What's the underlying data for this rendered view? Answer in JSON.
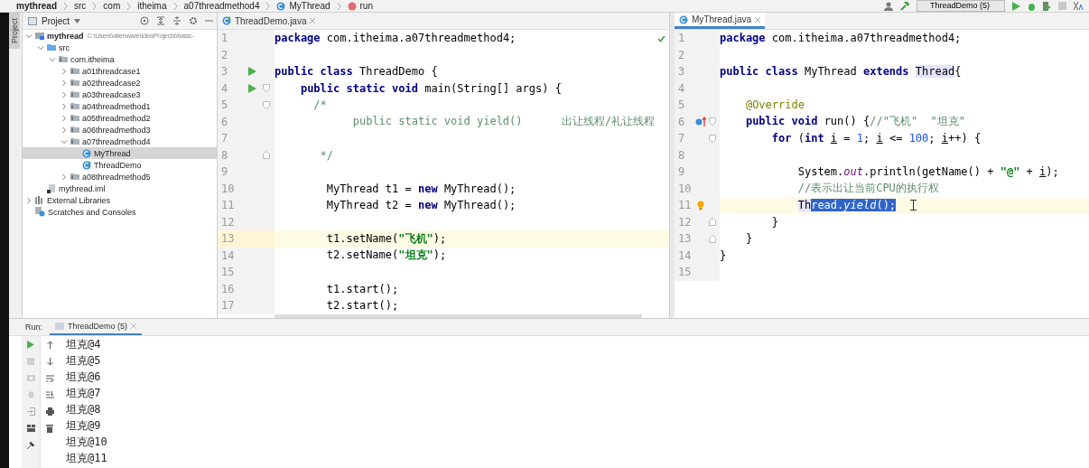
{
  "breadcrumbs": [
    {
      "label": "mythread",
      "kind": "module"
    },
    {
      "label": "src",
      "kind": "folder"
    },
    {
      "label": "com",
      "kind": "folder"
    },
    {
      "label": "itheima",
      "kind": "folder"
    },
    {
      "label": "a07threadmethod4",
      "kind": "folder"
    },
    {
      "label": "MyThread",
      "kind": "class"
    },
    {
      "label": "run",
      "kind": "method"
    }
  ],
  "run_config": {
    "label": "ThreadDemo (5)"
  },
  "tool_strip": {
    "label": "Project",
    "selected": true
  },
  "project_panel": {
    "title": "Project",
    "tree": [
      {
        "label": "mythread",
        "path": "C:\\Users\\alienware\\IdeaProjects\\basic-",
        "kind": "module",
        "expanded": true,
        "selected": false,
        "children": [
          {
            "label": "src",
            "kind": "folder",
            "expanded": true,
            "selected": false,
            "children": [
              {
                "label": "com.itheima",
                "kind": "package",
                "expanded": true,
                "selected": false,
                "children": [
                  {
                    "label": "a01threadcase1",
                    "kind": "package",
                    "expanded": false,
                    "selected": false
                  },
                  {
                    "label": "a02threadcase2",
                    "kind": "package",
                    "expanded": false,
                    "selected": false
                  },
                  {
                    "label": "a03threadcase3",
                    "kind": "package",
                    "expanded": false,
                    "selected": false
                  },
                  {
                    "label": "a04threadmethod1",
                    "kind": "package",
                    "expanded": false,
                    "selected": false
                  },
                  {
                    "label": "a05threadmethod2",
                    "kind": "package",
                    "expanded": false,
                    "selected": false
                  },
                  {
                    "label": "a06threadmethod3",
                    "kind": "package",
                    "expanded": false,
                    "selected": false
                  },
                  {
                    "label": "a07threadmethod4",
                    "kind": "package",
                    "expanded": true,
                    "selected": false,
                    "children": [
                      {
                        "label": "MyThread",
                        "kind": "class",
                        "selected": true
                      },
                      {
                        "label": "ThreadDemo",
                        "kind": "runclass",
                        "selected": false
                      }
                    ]
                  },
                  {
                    "label": "a08threadmethod5",
                    "kind": "package",
                    "expanded": false,
                    "selected": false
                  }
                ]
              }
            ]
          },
          {
            "label": "mythread.iml",
            "kind": "file",
            "selected": false
          }
        ]
      },
      {
        "label": "External Libraries",
        "kind": "library",
        "expanded": false,
        "selected": false
      },
      {
        "label": "Scratches and Consoles",
        "kind": "scratches",
        "selected": false
      }
    ]
  },
  "editors": [
    {
      "tab": {
        "label": "ThreadDemo.java",
        "kind": "runclass",
        "selected": false
      },
      "inspection_ok": true,
      "lines": [
        {
          "number": "1",
          "current": false,
          "tokens": [
            {
              "kind": "kw",
              "text": "package"
            },
            {
              "kind": "txt",
              "text": " com.itheima.a07threadmethod4;"
            }
          ]
        },
        {
          "number": "2",
          "current": false
        },
        {
          "number": "3",
          "current": false,
          "gutter_icon": {
            "kind": "run"
          },
          "tokens": [
            {
              "kind": "kw",
              "text": "public class"
            },
            {
              "kind": "txt",
              "text": " ThreadDemo {"
            }
          ]
        },
        {
          "number": "4",
          "current": false,
          "gutter_icon": {
            "kind": "run"
          },
          "fold_mark": {
            "kind": "start"
          },
          "tokens": [
            {
              "kind": "kw",
              "text": "    public static void"
            },
            {
              "kind": "txt",
              "text": " main(String[] args) {"
            }
          ]
        },
        {
          "number": "5",
          "current": false,
          "fold_mark": {
            "kind": "start"
          },
          "tokens": [
            {
              "kind": "cmt",
              "text": "      /*"
            }
          ]
        },
        {
          "number": "6",
          "current": false,
          "tokens": [
            {
              "kind": "cmt",
              "text": "            public static void yield()      出让线程/礼让线程"
            }
          ]
        },
        {
          "number": "7",
          "current": false
        },
        {
          "number": "8",
          "current": false,
          "fold_mark": {
            "kind": "end"
          },
          "tokens": [
            {
              "kind": "cmt",
              "text": "       */"
            }
          ]
        },
        {
          "number": "9",
          "current": false
        },
        {
          "number": "10",
          "current": false,
          "tokens": [
            {
              "kind": "txt",
              "text": "        MyThread t1 = "
            },
            {
              "kind": "kw",
              "text": "new"
            },
            {
              "kind": "txt",
              "text": " MyThread();"
            }
          ]
        },
        {
          "number": "11",
          "current": false,
          "tokens": [
            {
              "kind": "txt",
              "text": "        MyThread t2 = "
            },
            {
              "kind": "kw",
              "text": "new"
            },
            {
              "kind": "txt",
              "text": " MyThread();"
            }
          ]
        },
        {
          "number": "12",
          "current": false
        },
        {
          "number": "13",
          "current": true,
          "tokens": [
            {
              "kind": "txt",
              "text": "        t1.setName("
            },
            {
              "kind": "str",
              "text": "\"飞机\""
            },
            {
              "kind": "txt",
              "text": ");"
            }
          ]
        },
        {
          "number": "14",
          "current": false,
          "tokens": [
            {
              "kind": "txt",
              "text": "        t2.setName("
            },
            {
              "kind": "str",
              "text": "\"坦克\""
            },
            {
              "kind": "txt",
              "text": ");"
            }
          ]
        },
        {
          "number": "15",
          "current": false
        },
        {
          "number": "16",
          "current": false,
          "tokens": [
            {
              "kind": "txt",
              "text": "        t1.start();"
            }
          ]
        },
        {
          "number": "17",
          "current": false,
          "tokens": [
            {
              "kind": "txt",
              "text": "        t2.start();"
            }
          ]
        }
      ]
    },
    {
      "tab": {
        "label": "MyThread.java",
        "kind": "class",
        "selected": true
      },
      "inspection_ok": false,
      "lines": [
        {
          "number": "1",
          "current": false,
          "tokens": [
            {
              "kind": "kw",
              "text": "package"
            },
            {
              "kind": "txt",
              "text": " com.itheima.a07threadmethod4;"
            }
          ]
        },
        {
          "number": "2",
          "current": false
        },
        {
          "number": "3",
          "current": false,
          "tokens": [
            {
              "kind": "kw",
              "text": "public class"
            },
            {
              "kind": "txt",
              "text": " MyThread "
            },
            {
              "kind": "kw",
              "text": "extends "
            },
            {
              "kind": "hl",
              "text": "Thread"
            },
            {
              "kind": "txt",
              "text": "{"
            }
          ]
        },
        {
          "number": "4",
          "current": false
        },
        {
          "number": "5",
          "current": false,
          "tokens": [
            {
              "kind": "ann",
              "text": "    @Override"
            }
          ]
        },
        {
          "number": "6",
          "current": false,
          "gutter_icon": {
            "kind": "override"
          },
          "fold_mark": {
            "kind": "start"
          },
          "tokens": [
            {
              "kind": "kw",
              "text": "    public void"
            },
            {
              "kind": "txt",
              "text": " run() {"
            },
            {
              "kind": "cmt",
              "text": "//\"飞机\"  \"坦克\""
            }
          ]
        },
        {
          "number": "7",
          "current": false,
          "fold_mark": {
            "kind": "start"
          },
          "tokens": [
            {
              "kind": "kw",
              "text": "        for"
            },
            {
              "kind": "txt",
              "text": " ("
            },
            {
              "kind": "kw",
              "text": "int "
            },
            {
              "kind": "var",
              "text": "i"
            },
            {
              "kind": "txt",
              "text": " = "
            },
            {
              "kind": "num",
              "text": "1"
            },
            {
              "kind": "txt",
              "text": "; "
            },
            {
              "kind": "var",
              "text": "i"
            },
            {
              "kind": "txt",
              "text": " <= "
            },
            {
              "kind": "num",
              "text": "100"
            },
            {
              "kind": "txt",
              "text": "; "
            },
            {
              "kind": "var",
              "text": "i"
            },
            {
              "kind": "txt",
              "text": "++) {"
            }
          ]
        },
        {
          "number": "8",
          "current": false
        },
        {
          "number": "9",
          "current": false,
          "tokens": [
            {
              "kind": "txt",
              "text": "            System."
            },
            {
              "kind": "field",
              "text": "out"
            },
            {
              "kind": "txt",
              "text": ".println(getName() + "
            },
            {
              "kind": "str",
              "text": "\"@\""
            },
            {
              "kind": "txt",
              "text": " + "
            },
            {
              "kind": "var",
              "text": "i"
            },
            {
              "kind": "txt",
              "text": ");"
            }
          ]
        },
        {
          "number": "10",
          "current": false,
          "tokens": [
            {
              "kind": "cmt",
              "text": "            //表示出让当前CPU的执行权"
            }
          ]
        },
        {
          "number": "11",
          "current": true,
          "gutter_icon": {
            "kind": "bulb"
          },
          "mouse_pointer": true,
          "tokens": [
            {
              "kind": "hl",
              "text": "            Th"
            },
            {
              "kind": "sel",
              "text": "read."
            },
            {
              "kind": "sel-italic",
              "text": "yield"
            },
            {
              "kind": "sel",
              "text": "();"
            }
          ]
        },
        {
          "number": "12",
          "current": false,
          "fold_mark": {
            "kind": "end"
          },
          "tokens": [
            {
              "kind": "txt",
              "text": "        }"
            }
          ]
        },
        {
          "number": "13",
          "current": false,
          "fold_mark": {
            "kind": "end"
          },
          "tokens": [
            {
              "kind": "txt",
              "text": "    }"
            }
          ]
        },
        {
          "number": "14",
          "current": false,
          "tokens": [
            {
              "kind": "txt",
              "text": "}"
            }
          ]
        },
        {
          "number": "15",
          "current": false
        }
      ]
    }
  ],
  "run_panel": {
    "label": "Run:",
    "tab": {
      "label": "ThreadDemo (5)",
      "selected": true
    },
    "output": [
      "坦克@4",
      "坦克@5",
      "坦克@6",
      "坦克@7",
      "坦克@8",
      "坦克@9",
      "坦克@10",
      "坦克@11"
    ]
  }
}
